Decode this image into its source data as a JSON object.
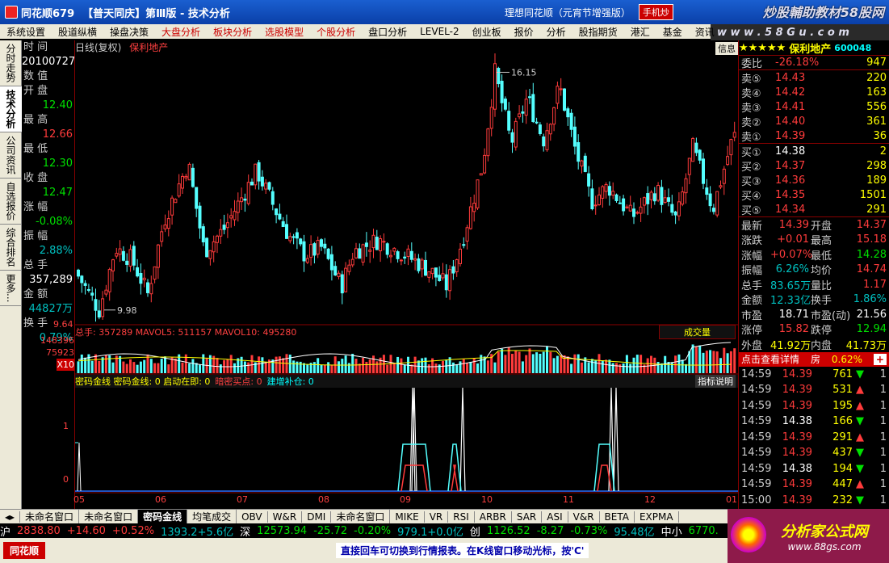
{
  "window": {
    "title_app": "同花顺679",
    "title_doc": "【普天同庆】第Ⅲ版 - 技术分析",
    "title_right": "理想同花顺（元宵节增强版）",
    "mode_label": "手机炒",
    "watermark": "炒股輔助教材58股网",
    "watermark_url": "w w w . 5 8 G u . c o m"
  },
  "menu": [
    "系统设置",
    "股道纵横",
    "操盘决策",
    "大盘分析",
    "板块分析",
    "选股模型",
    "个股分析",
    "盘口分析",
    "LEVEL-2",
    "创业板",
    "报价",
    "分析",
    "股指期货",
    "港汇",
    "基金",
    "资讯"
  ],
  "menu_highlight": [
    "大盘分析",
    "板块分析",
    "选股模型",
    "个股分析"
  ],
  "left_tabs": [
    "分时走势",
    "技术分析",
    "公司资讯",
    "自选报价",
    "综合排名",
    "更多..."
  ],
  "left_tabs_active": 1,
  "info": {
    "time_k": "时    间",
    "time_v": "20100727",
    "num_k": "数    值",
    "open_k": "开    盘",
    "open_v": "12.40",
    "high_k": "最    高",
    "high_v": "12.66",
    "low_k": "最    低",
    "low_v": "12.30",
    "close_k": "收    盘",
    "close_v": "12.47",
    "chg_k": "涨    幅",
    "chg_v": "-0.08%",
    "amp_k": "振    幅",
    "amp_v": "2.88%",
    "vol_k": "总    手",
    "vol_v": "357,289",
    "amt_k": "金    额",
    "amt_v": "44827万",
    "turn_k": "换    手",
    "turn_v": "0.79%"
  },
  "chart": {
    "header": "日线(复权)",
    "stock": "保利地产",
    "info_btn": "信息",
    "high_label": "16.15",
    "low_label": "9.98",
    "price_axis_bottom": "9.64",
    "vol_line": "总手: 357289  MAVOL5: 511157  MAVOL10: 495280",
    "vol_select": "成交量",
    "vol_axis": [
      "148396",
      "75923",
      "X10"
    ],
    "ind_line_a": "密码金线  密码金线: 0  启动在即: 0",
    "ind_line_b": "暗密买点: 0",
    "ind_line_c": "建增补仓: 0",
    "ind_btn": "指标说明",
    "ind_axis": [
      "1",
      "0"
    ],
    "months": [
      "05",
      "06",
      "07",
      "08",
      "09",
      "10",
      "11",
      "12",
      "01"
    ]
  },
  "chart_data": {
    "type": "candlestick",
    "stock": "保利地产",
    "period": "daily",
    "high_marker": 16.15,
    "low_marker": 9.98,
    "ylim": [
      9.64,
      16.6
    ]
  },
  "right": {
    "stars": "★★★★★",
    "name": "保利地产",
    "code": "600048",
    "weibi_k": "委比",
    "weibi_v": "-26.18%",
    "weibi_n": "947",
    "sells": [
      {
        "k": "卖⑤",
        "p": "14.43",
        "v": "220"
      },
      {
        "k": "卖④",
        "p": "14.42",
        "v": "163"
      },
      {
        "k": "卖③",
        "p": "14.41",
        "v": "556"
      },
      {
        "k": "卖②",
        "p": "14.40",
        "v": "361"
      },
      {
        "k": "卖①",
        "p": "14.39",
        "v": "36"
      }
    ],
    "buys": [
      {
        "k": "买①",
        "p": "14.38",
        "v": "2"
      },
      {
        "k": "买②",
        "p": "14.37",
        "v": "298"
      },
      {
        "k": "买③",
        "p": "14.36",
        "v": "189"
      },
      {
        "k": "买④",
        "p": "14.35",
        "v": "1501"
      },
      {
        "k": "买⑤",
        "p": "14.34",
        "v": "291"
      }
    ],
    "stats": [
      {
        "a": "最新",
        "b": "14.39",
        "c": "开盘",
        "d": "14.37"
      },
      {
        "a": "涨跌",
        "b": "+0.01",
        "c": "最高",
        "d": "15.18"
      },
      {
        "a": "涨幅",
        "b": "+0.07%",
        "c": "最低",
        "d": "14.28"
      },
      {
        "a": "振幅",
        "b": "6.26%",
        "c": "均价",
        "d": "14.74"
      },
      {
        "a": "总手",
        "b": "83.65万",
        "c": "量比",
        "d": "1.17"
      },
      {
        "a": "金额",
        "b": "12.33亿",
        "c": "换手",
        "d": "1.86%"
      },
      {
        "a": "市盈",
        "b": "18.71",
        "c": "市盈(动)",
        "d": "21.56"
      },
      {
        "a": "涨停",
        "b": "15.82",
        "c": "跌停",
        "d": "12.94"
      },
      {
        "a": "外盘",
        "b": "41.92万",
        "c": "内盘",
        "d": "41.73万"
      }
    ],
    "detail_btn": "点击查看详情",
    "detail_tag": "房",
    "detail_pct": "0.62%",
    "ticks": [
      {
        "t": "14:59",
        "p": "14.39",
        "v": "761",
        "d": "down",
        "n": "1"
      },
      {
        "t": "14:59",
        "p": "14.39",
        "v": "531",
        "d": "up",
        "n": "1"
      },
      {
        "t": "14:59",
        "p": "14.39",
        "v": "195",
        "d": "up",
        "n": "1"
      },
      {
        "t": "14:59",
        "p": "14.38",
        "v": "166",
        "d": "down",
        "n": "1"
      },
      {
        "t": "14:59",
        "p": "14.39",
        "v": "291",
        "d": "up",
        "n": "1"
      },
      {
        "t": "14:59",
        "p": "14.39",
        "v": "437",
        "d": "down",
        "n": "1"
      },
      {
        "t": "14:59",
        "p": "14.38",
        "v": "194",
        "d": "down",
        "n": "1"
      },
      {
        "t": "14:59",
        "p": "14.39",
        "v": "447",
        "d": "up",
        "n": "1"
      },
      {
        "t": "15:00",
        "p": "14.39",
        "v": "232",
        "d": "down",
        "n": "1"
      }
    ],
    "tabs": [
      "细",
      "盘",
      "分",
      "笔"
    ]
  },
  "bottom_tabs": [
    "未命名窗口",
    "未命名窗口",
    "密码金线",
    "均笔成交",
    "OBV",
    "W&R",
    "DMI",
    "未命名窗口",
    "MIKE",
    "VR",
    "RSI",
    "ARBR",
    "SAR",
    "ASI",
    "V&R",
    "BETA",
    "EXPMA"
  ],
  "bottom_tabs_active": 2,
  "status": {
    "sh_k": "沪",
    "sh_v": "2838.80",
    "sh_c": "+14.60",
    "sh_p": "+0.52%",
    "sh_a": "1393.2+5.6亿",
    "sz_k": "深",
    "sz_v": "12573.94",
    "sz_c": "-25.72",
    "sz_p": "-0.20%",
    "sz_a": "979.1+0.0亿",
    "cy_k": "创",
    "cy_v": "1126.52",
    "cy_c": "-8.27",
    "cy_p": "-0.73%",
    "cy_a": "95.48亿",
    "zx_k": "中小",
    "zx_v": "6770."
  },
  "footer": {
    "brand": "同花顺",
    "message": "直接回车可切换到行情报表。在K线窗口移动光标，按'C'",
    "logo_text": "分析家公式网",
    "logo_url": "www.88gs.com"
  }
}
